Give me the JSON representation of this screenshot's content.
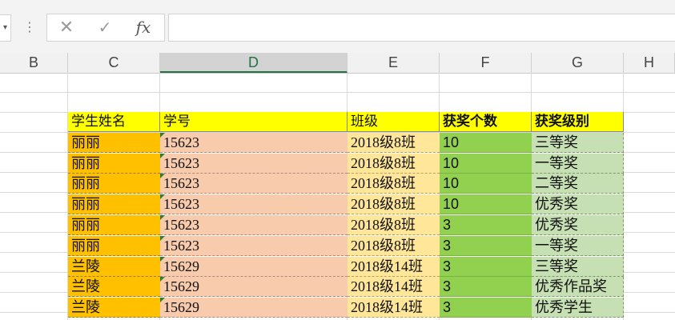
{
  "formula_bar": {
    "cancel_icon": "cancel-x-icon",
    "enter_icon": "checkmark-icon",
    "fx_label": "fx",
    "formula_value": ""
  },
  "columns": [
    "B",
    "C",
    "D",
    "E",
    "F",
    "G",
    "H"
  ],
  "selected_column": "D",
  "table": {
    "headers": [
      "学生姓名",
      "学号",
      "班级",
      "获奖个数",
      "获奖级别"
    ],
    "rows": [
      [
        "丽丽",
        "15623",
        "2018级8班",
        "10",
        "三等奖"
      ],
      [
        "丽丽",
        "15623",
        "2018级8班",
        "10",
        "一等奖"
      ],
      [
        "丽丽",
        "15623",
        "2018级8班",
        "10",
        "二等奖"
      ],
      [
        "丽丽",
        "15623",
        "2018级8班",
        "10",
        "优秀奖"
      ],
      [
        "丽丽",
        "15623",
        "2018级8班",
        "3",
        "优秀奖"
      ],
      [
        "丽丽",
        "15623",
        "2018级8班",
        "3",
        "一等奖"
      ],
      [
        "兰陵",
        "15629",
        "2018级14班",
        "3",
        "三等奖"
      ],
      [
        "兰陵",
        "15629",
        "2018级14班",
        "3",
        "优秀作品奖"
      ],
      [
        "兰陵",
        "15629",
        "2018级14班",
        "3",
        "优秀学生"
      ]
    ]
  },
  "colors": {
    "header_fill": "#ffff00",
    "name_fill": "#ffc000",
    "id_fill": "#f8cbad",
    "class_fill": "#ffe699",
    "count_fill": "#92d050",
    "level_fill": "#c6e0b4",
    "selected_col_accent": "#217346"
  }
}
